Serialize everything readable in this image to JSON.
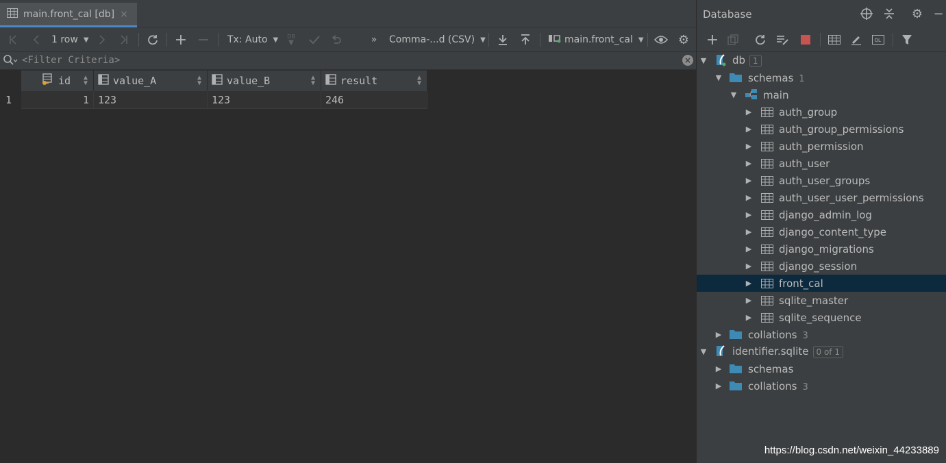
{
  "tab": {
    "label": "main.front_cal [db]",
    "close": "×"
  },
  "toolbar": {
    "rows_label": "1 row",
    "tx_label": "Tx: Auto",
    "db_mini": "DB",
    "more": "»",
    "extractor_label": "Comma-...d (CSV)",
    "target_label": "main.front_cal"
  },
  "filter": {
    "placeholder": "<Filter Criteria>"
  },
  "grid": {
    "columns": [
      {
        "name": "id"
      },
      {
        "name": "value_A"
      },
      {
        "name": "value_B"
      },
      {
        "name": "result"
      }
    ],
    "rows": [
      {
        "num": "1",
        "cells": [
          "1",
          "123",
          "123",
          "246"
        ]
      }
    ]
  },
  "database_panel": {
    "title": "Database",
    "tree": [
      {
        "label": "db",
        "badge": "1"
      },
      {
        "label": "schemas",
        "count": "1"
      },
      {
        "label": "main"
      },
      {
        "label": "auth_group"
      },
      {
        "label": "auth_group_permissions"
      },
      {
        "label": "auth_permission"
      },
      {
        "label": "auth_user"
      },
      {
        "label": "auth_user_groups"
      },
      {
        "label": "auth_user_user_permissions"
      },
      {
        "label": "django_admin_log"
      },
      {
        "label": "django_content_type"
      },
      {
        "label": "django_migrations"
      },
      {
        "label": "django_session"
      },
      {
        "label": "front_cal",
        "selected": true
      },
      {
        "label": "sqlite_master"
      },
      {
        "label": "sqlite_sequence"
      },
      {
        "label": "collations",
        "count": "3"
      },
      {
        "label": "identifier.sqlite",
        "badge": "0 of 1"
      },
      {
        "label": "schemas"
      },
      {
        "label": "collations",
        "count": "3"
      }
    ]
  },
  "watermark": "https://blog.csdn.net/weixin_44233889",
  "colors": {
    "accent": "#4a88c7",
    "selection": "#0d293e",
    "stop": "#c75450",
    "folder": "#3d8bb5"
  }
}
